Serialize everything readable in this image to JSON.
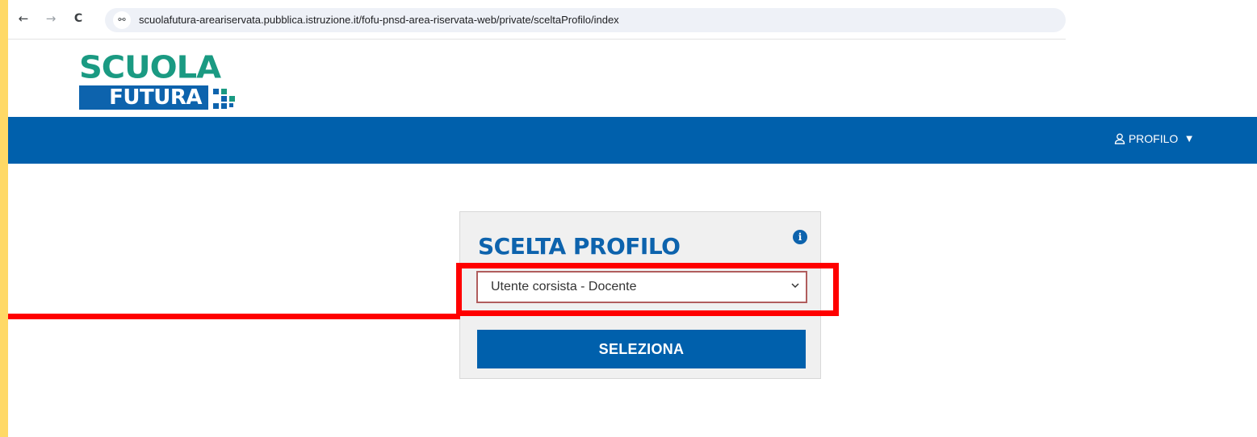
{
  "browser": {
    "url": "scuolafutura-areariservata.pubblica.istruzione.it/fofu-pnsd-area-riservata-web/private/sceltaProfilo/index",
    "back_icon": "←",
    "forward_icon": "→",
    "reload_icon": "C",
    "site_info_icon": "⚯"
  },
  "logo": {
    "top": "SCUOLA",
    "bottom": "FUTURA"
  },
  "navbar": {
    "profile_label": "PROFILO",
    "caret": "▼"
  },
  "card": {
    "title": "SCELTA PROFILO",
    "info_icon": "i",
    "select_value": "Utente corsista - Docente",
    "select_arrow": "⌄",
    "submit_label": "SELEZIONA"
  },
  "colors": {
    "brand_blue": "#0060ac",
    "brand_green": "#1a9a82",
    "annotation_red": "#ff0000",
    "frame_yellow": "#ffd966"
  }
}
